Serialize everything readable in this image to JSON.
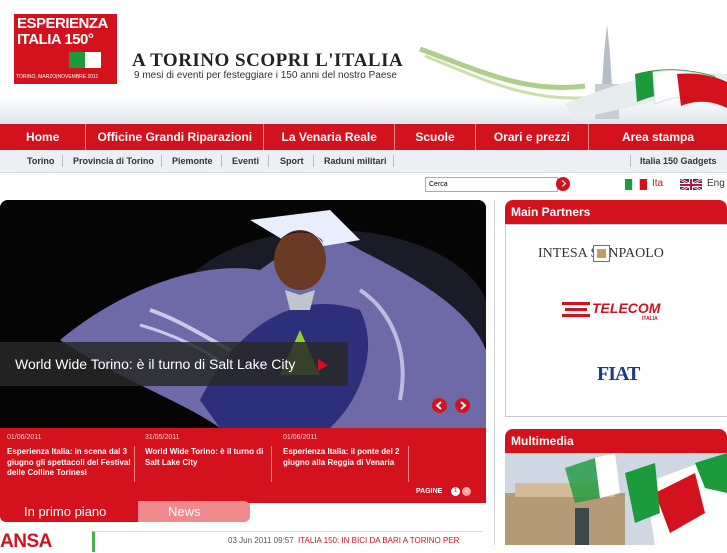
{
  "logo": {
    "line1": "ESPERIENZA",
    "line2": "ITALIA 150°",
    "tagline": "TORINO, MARZO|NOVEMBRE 2011"
  },
  "brand": {
    "title": "A TORINO SCOPRI L'ITALIA",
    "subtitle": "9 mesi di eventi per festeggiare i 150 anni del nostro Paese"
  },
  "main_nav": [
    {
      "label": "Home"
    },
    {
      "label": "Officine Grandi Riparazioni"
    },
    {
      "label": "La Venaria Reale"
    },
    {
      "label": "Scuole"
    },
    {
      "label": "Orari e prezzi"
    },
    {
      "label": "Area stampa"
    }
  ],
  "sub_nav": [
    {
      "label": "Torino"
    },
    {
      "label": "Provincia di Torino"
    },
    {
      "label": "Piemonte"
    },
    {
      "label": "Eventi"
    },
    {
      "label": "Sport"
    },
    {
      "label": "Raduni militari"
    }
  ],
  "gadgets_label": "Italia 150 Gadgets",
  "search": {
    "placeholder": "Cerca"
  },
  "languages": [
    {
      "label": "Ita",
      "icon": "italy-flag-icon"
    },
    {
      "label": "Eng",
      "icon": "uk-flag-icon"
    }
  ],
  "hero": {
    "caption": "World Wide Torino: è il turno di Salt Lake City"
  },
  "news": [
    {
      "date": "01/06/2011",
      "title": "Esperienza Italia: in scena dal 3 giugno gli spettacoli del Festival delle Colline Torinesi"
    },
    {
      "date": "31/05/2011",
      "title": "World Wide Torino: è il turno di Salt Lake City"
    },
    {
      "date": "01/06/2011",
      "title": "Esperienza Italia: il ponte del 2 giugno alla Reggia di Venaria"
    }
  ],
  "pagination": {
    "label": "PAGINE",
    "pages": [
      "1",
      "2"
    ],
    "current": "1"
  },
  "tabs": [
    {
      "label": "In primo piano"
    },
    {
      "label": "News"
    }
  ],
  "ansa": {
    "logo": "ANSA",
    "timestamp": "03 Jun 2011 09:57",
    "headline": "ITALIA 150: IN BICI DA BARI A TORINO PER"
  },
  "sidebar": {
    "partners_title": "Main Partners",
    "partners": [
      {
        "name": "INTESA SANPAOLO",
        "sub": ""
      },
      {
        "name": "TELECOM",
        "sub": "ITALIA"
      },
      {
        "name": "FIAT",
        "sub": ""
      }
    ],
    "multimedia_title": "Multimedia"
  },
  "colors": {
    "brand_red": "#d3121e",
    "light_red": "#f08a8f",
    "italy_green": "#1c9a3c",
    "italy_red": "#d3121e"
  }
}
